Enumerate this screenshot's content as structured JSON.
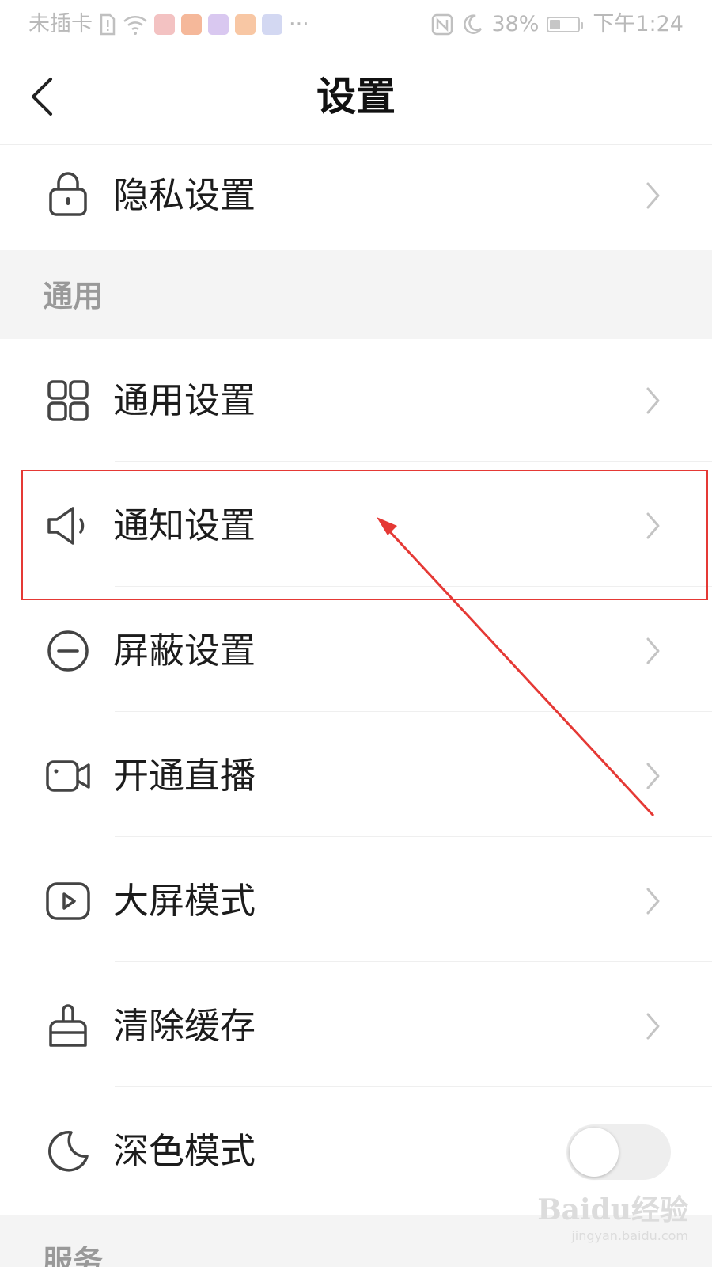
{
  "status_bar": {
    "carrier": "未插卡",
    "battery": "38%",
    "battery_level": 0.38,
    "time": "下午1:24",
    "more": "···"
  },
  "header": {
    "title": "设置"
  },
  "rows": {
    "privacy": "隐私设置",
    "general_settings": "通用设置",
    "notification": "通知设置",
    "block": "屏蔽设置",
    "live": "开通直播",
    "big_screen": "大屏模式",
    "clear_cache": "清除缓存",
    "dark_mode": "深色模式"
  },
  "sections": {
    "general": "通用",
    "services": "服务"
  },
  "dark_mode_enabled": false,
  "colors": {
    "annotation": "#e53935",
    "status_text": "#b9b9b9",
    "section_bg": "#f4f4f4"
  },
  "watermark": {
    "logo": "Baidu经验",
    "sub": "jingyan.baidu.com"
  }
}
